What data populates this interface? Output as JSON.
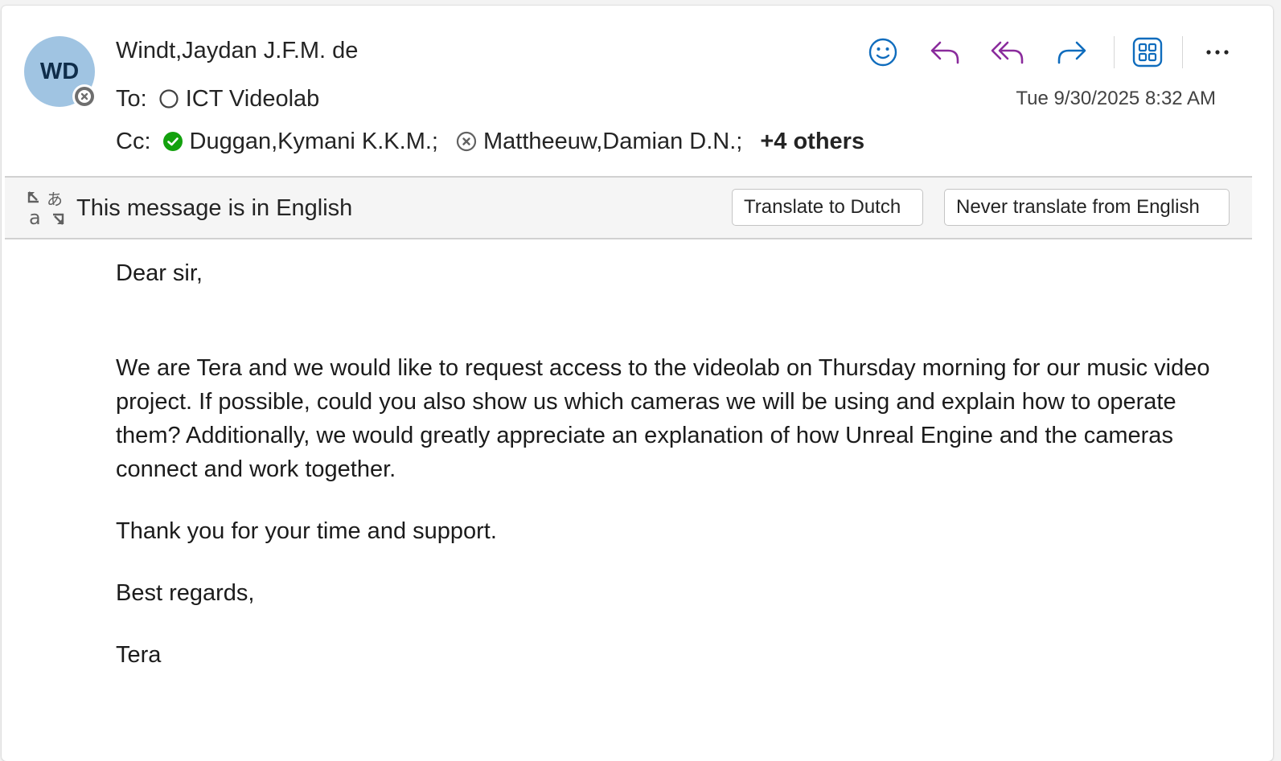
{
  "header": {
    "avatar_initials": "WD",
    "avatar_color": "#a0c4e2",
    "sender_name": "Windt,Jaydan J.F.M. de",
    "to_label": "To:",
    "to_recipients": [
      {
        "name": "ICT Videolab",
        "status": "unknown"
      }
    ],
    "cc_label": "Cc:",
    "cc_recipients": [
      {
        "name": "Duggan,Kymani K.K.M.;",
        "status": "available"
      },
      {
        "name": "Mattheeuw,Damian D.N.;",
        "status": "offline"
      }
    ],
    "cc_more": "+4 others",
    "timestamp": "Tue 9/30/2025 8:32 AM",
    "toolbar_icons": [
      "emoji-icon",
      "reply-icon",
      "reply-all-icon",
      "forward-icon",
      "apps-icon",
      "more-icon"
    ],
    "accent_color": "#0f6cbd",
    "reply_color": "#8a2b9c"
  },
  "translate_bar": {
    "message": "This message is in English",
    "translate_button": "Translate to Dutch",
    "never_button": "Never translate from English"
  },
  "body": {
    "greeting": "Dear sir,",
    "paragraph1": "We are Tera and we would like to request access to the videolab  on Thursday morning for our music video project. If possible, could you also show us which cameras we will be using and explain how to operate them? Additionally, we would greatly appreciate an explanation of how Unreal Engine and the cameras connect and work together.",
    "paragraph2": "Thank you for your time and support.",
    "closing": "Best regards,",
    "signature": "Tera"
  }
}
